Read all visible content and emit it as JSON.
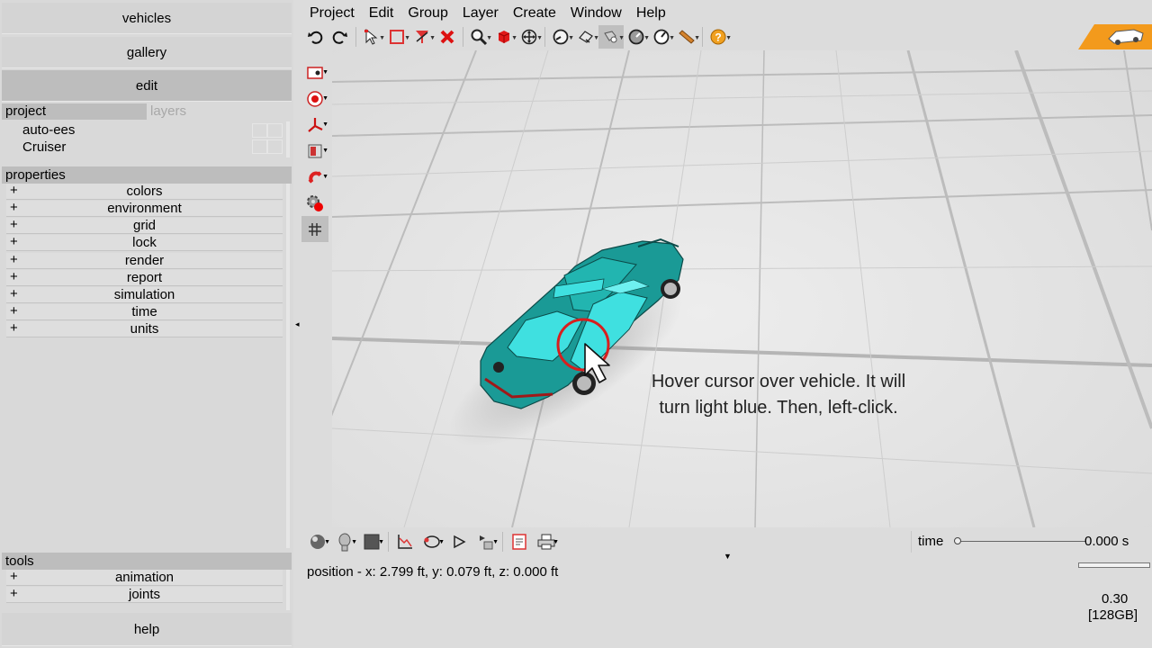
{
  "nav": {
    "vehicles": "vehicles",
    "gallery": "gallery",
    "edit": "edit",
    "help": "help"
  },
  "project_panel": {
    "tab_project": "project",
    "tab_layers": "layers",
    "items": [
      "auto-ees",
      "Cruiser"
    ]
  },
  "properties": {
    "header": "properties",
    "items": [
      "colors",
      "environment",
      "grid",
      "lock",
      "render",
      "report",
      "simulation",
      "time",
      "units"
    ]
  },
  "tools": {
    "header": "tools",
    "items": [
      "animation",
      "joints"
    ]
  },
  "expand_symbol": "+",
  "menu": [
    "Project",
    "Edit",
    "Group",
    "Layer",
    "Create",
    "Window",
    "Help"
  ],
  "timeline": {
    "label": "time",
    "value": "0.000 s",
    "progress": 0
  },
  "status": {
    "position": "position - x: 2.799 ft, y: 0.079 ft, z: 0.000 ft",
    "version": "0.30",
    "memory": "[128GB]"
  },
  "annotation": {
    "line1": "Hover cursor over vehicle. It will",
    "line2": "turn light blue. Then, left-click."
  },
  "colors": {
    "vehicle_body": "#1a9a96",
    "vehicle_highlight": "#3fe0e0",
    "callout_circle": "#d81e1e",
    "badge_orange": "#f39a1c"
  },
  "icons": {
    "toolbar": [
      "undo-icon",
      "redo-icon",
      "select-arrow-icon",
      "select-box-icon",
      "filter-icon",
      "delete-icon",
      "zoom-icon",
      "cube-icon",
      "pan-icon",
      "measure-icon",
      "surface-icon",
      "light-icon",
      "gauge-icon",
      "angle-icon",
      "tool-icon",
      "help-icon"
    ],
    "vertical": [
      "camera-icon",
      "target-icon",
      "axes-icon",
      "door-icon",
      "magnet-icon",
      "settings-record-icon",
      "grid-icon"
    ],
    "bottom": [
      "sphere-icon",
      "head-icon",
      "color-square-icon",
      "graph-icon",
      "path-icon",
      "play-icon",
      "sequence-icon",
      "report-icon",
      "print-icon"
    ]
  }
}
